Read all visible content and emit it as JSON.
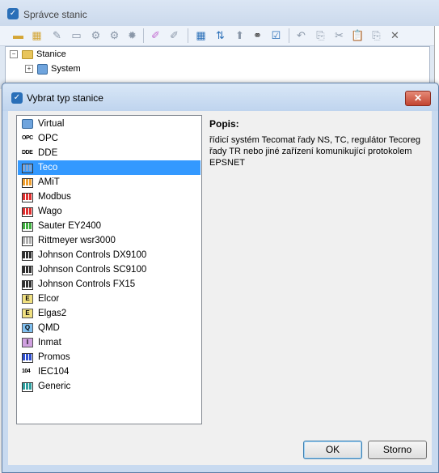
{
  "background_window": {
    "title": "Správce stanic",
    "tree": [
      {
        "label": "Stanice",
        "expander": "−"
      },
      {
        "label": "System",
        "expander": "+"
      }
    ]
  },
  "dialog": {
    "title": "Vybrat typ stanice",
    "close_glyph": "✕",
    "station_types": [
      {
        "label": "Virtual",
        "icon": "monitor-icon"
      },
      {
        "label": "OPC",
        "icon": "opc-icon",
        "icon_text": "OPC"
      },
      {
        "label": "DDE",
        "icon": "dde-icon",
        "icon_text": "DDE"
      },
      {
        "label": "Teco",
        "icon": "plc-bars-icon",
        "color": "#7fa6d6",
        "selected": true
      },
      {
        "label": "AMiT",
        "icon": "plc-bars-icon",
        "color": "#f0a030"
      },
      {
        "label": "Modbus",
        "icon": "plc-bars-icon",
        "color": "#e03030"
      },
      {
        "label": "Wago",
        "icon": "plc-bars-icon",
        "color": "#e03030"
      },
      {
        "label": "Sauter EY2400",
        "icon": "plc-bars-icon",
        "color": "#40b040"
      },
      {
        "label": "Rittmeyer wsr3000",
        "icon": "plc-bars-icon",
        "color": "#b0b0b0"
      },
      {
        "label": "Johnson Controls DX9100",
        "icon": "plc-bars-icon",
        "color": "#303030"
      },
      {
        "label": "Johnson Controls SC9100",
        "icon": "plc-bars-icon",
        "color": "#303030"
      },
      {
        "label": "Johnson Controls FX15",
        "icon": "plc-bars-icon",
        "color": "#303030"
      },
      {
        "label": "Elcor",
        "icon": "letter-e-icon",
        "letter": "E",
        "color": "#f0e080"
      },
      {
        "label": "Elgas2",
        "icon": "letter-e-icon",
        "letter": "E",
        "color": "#f0e080"
      },
      {
        "label": "QMD",
        "icon": "letter-q-icon",
        "letter": "Q",
        "color": "#80c0f0"
      },
      {
        "label": "Inmat",
        "icon": "letter-i-icon",
        "letter": "I",
        "color": "#d0a0e0"
      },
      {
        "label": "Promos",
        "icon": "plc-bars-icon",
        "color": "#3050d0"
      },
      {
        "label": "IEC104",
        "icon": "iec104-icon",
        "icon_text": "104"
      },
      {
        "label": "Generic",
        "icon": "plc-bars-icon",
        "color": "#30a0a0"
      }
    ],
    "description_label": "Popis:",
    "description_text": "řídicí systém Tecomat řady NS, TC, regulátor Tecoreg řady TR nebo jiné zařízení komunikující protokolem EPSNET",
    "ok_label": "OK",
    "cancel_label": "Storno"
  }
}
